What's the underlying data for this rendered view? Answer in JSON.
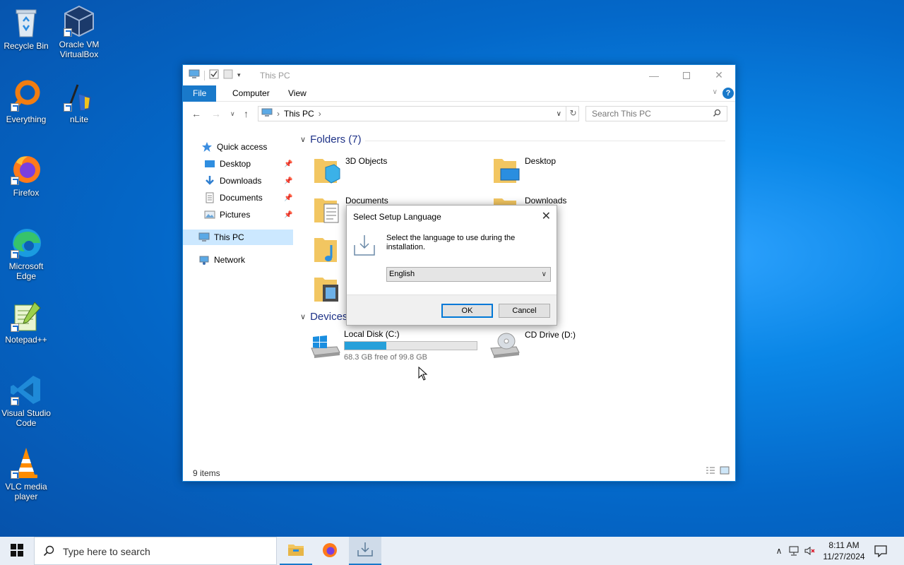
{
  "desktop": {
    "icons": [
      {
        "label": "Recycle Bin"
      },
      {
        "label": "Oracle VM VirtualBox"
      },
      {
        "label": "Everything"
      },
      {
        "label": "nLite"
      },
      {
        "label": "Firefox"
      },
      {
        "label": "Microsoft Edge"
      },
      {
        "label": "Notepad++"
      },
      {
        "label": "Visual Studio Code"
      },
      {
        "label": "VLC media player"
      }
    ]
  },
  "explorer": {
    "title": "This PC",
    "ribbon_tabs": [
      "File",
      "Computer",
      "View"
    ],
    "help": "?",
    "address": "This PC",
    "search_placeholder": "Search This PC",
    "sidebar": {
      "quick_access": "Quick access",
      "items": [
        "Desktop",
        "Downloads",
        "Documents",
        "Pictures"
      ],
      "this_pc": "This PC",
      "network": "Network"
    },
    "folders_header": "Folders (7)",
    "folders": [
      "3D Objects",
      "Desktop",
      "Documents",
      "Downloads"
    ],
    "devices_header": "Devices",
    "drives": {
      "c_name": "Local Disk (C:)",
      "c_free": "68.3 GB free of 99.8 GB",
      "c_used_fraction": 0.316,
      "d_name": "CD Drive (D:)"
    },
    "status": "9 items"
  },
  "dialog": {
    "title": "Select Setup Language",
    "message": "Select the language to use during the installation.",
    "selected_language": "English",
    "ok_label": "OK",
    "cancel_label": "Cancel"
  },
  "taskbar": {
    "search_placeholder": "Type here to search",
    "time": "8:11 AM",
    "date": "11/27/2024"
  },
  "colors": {
    "accent": "#1979ca",
    "selection": "#cce8ff",
    "progress": "#26a0da"
  }
}
